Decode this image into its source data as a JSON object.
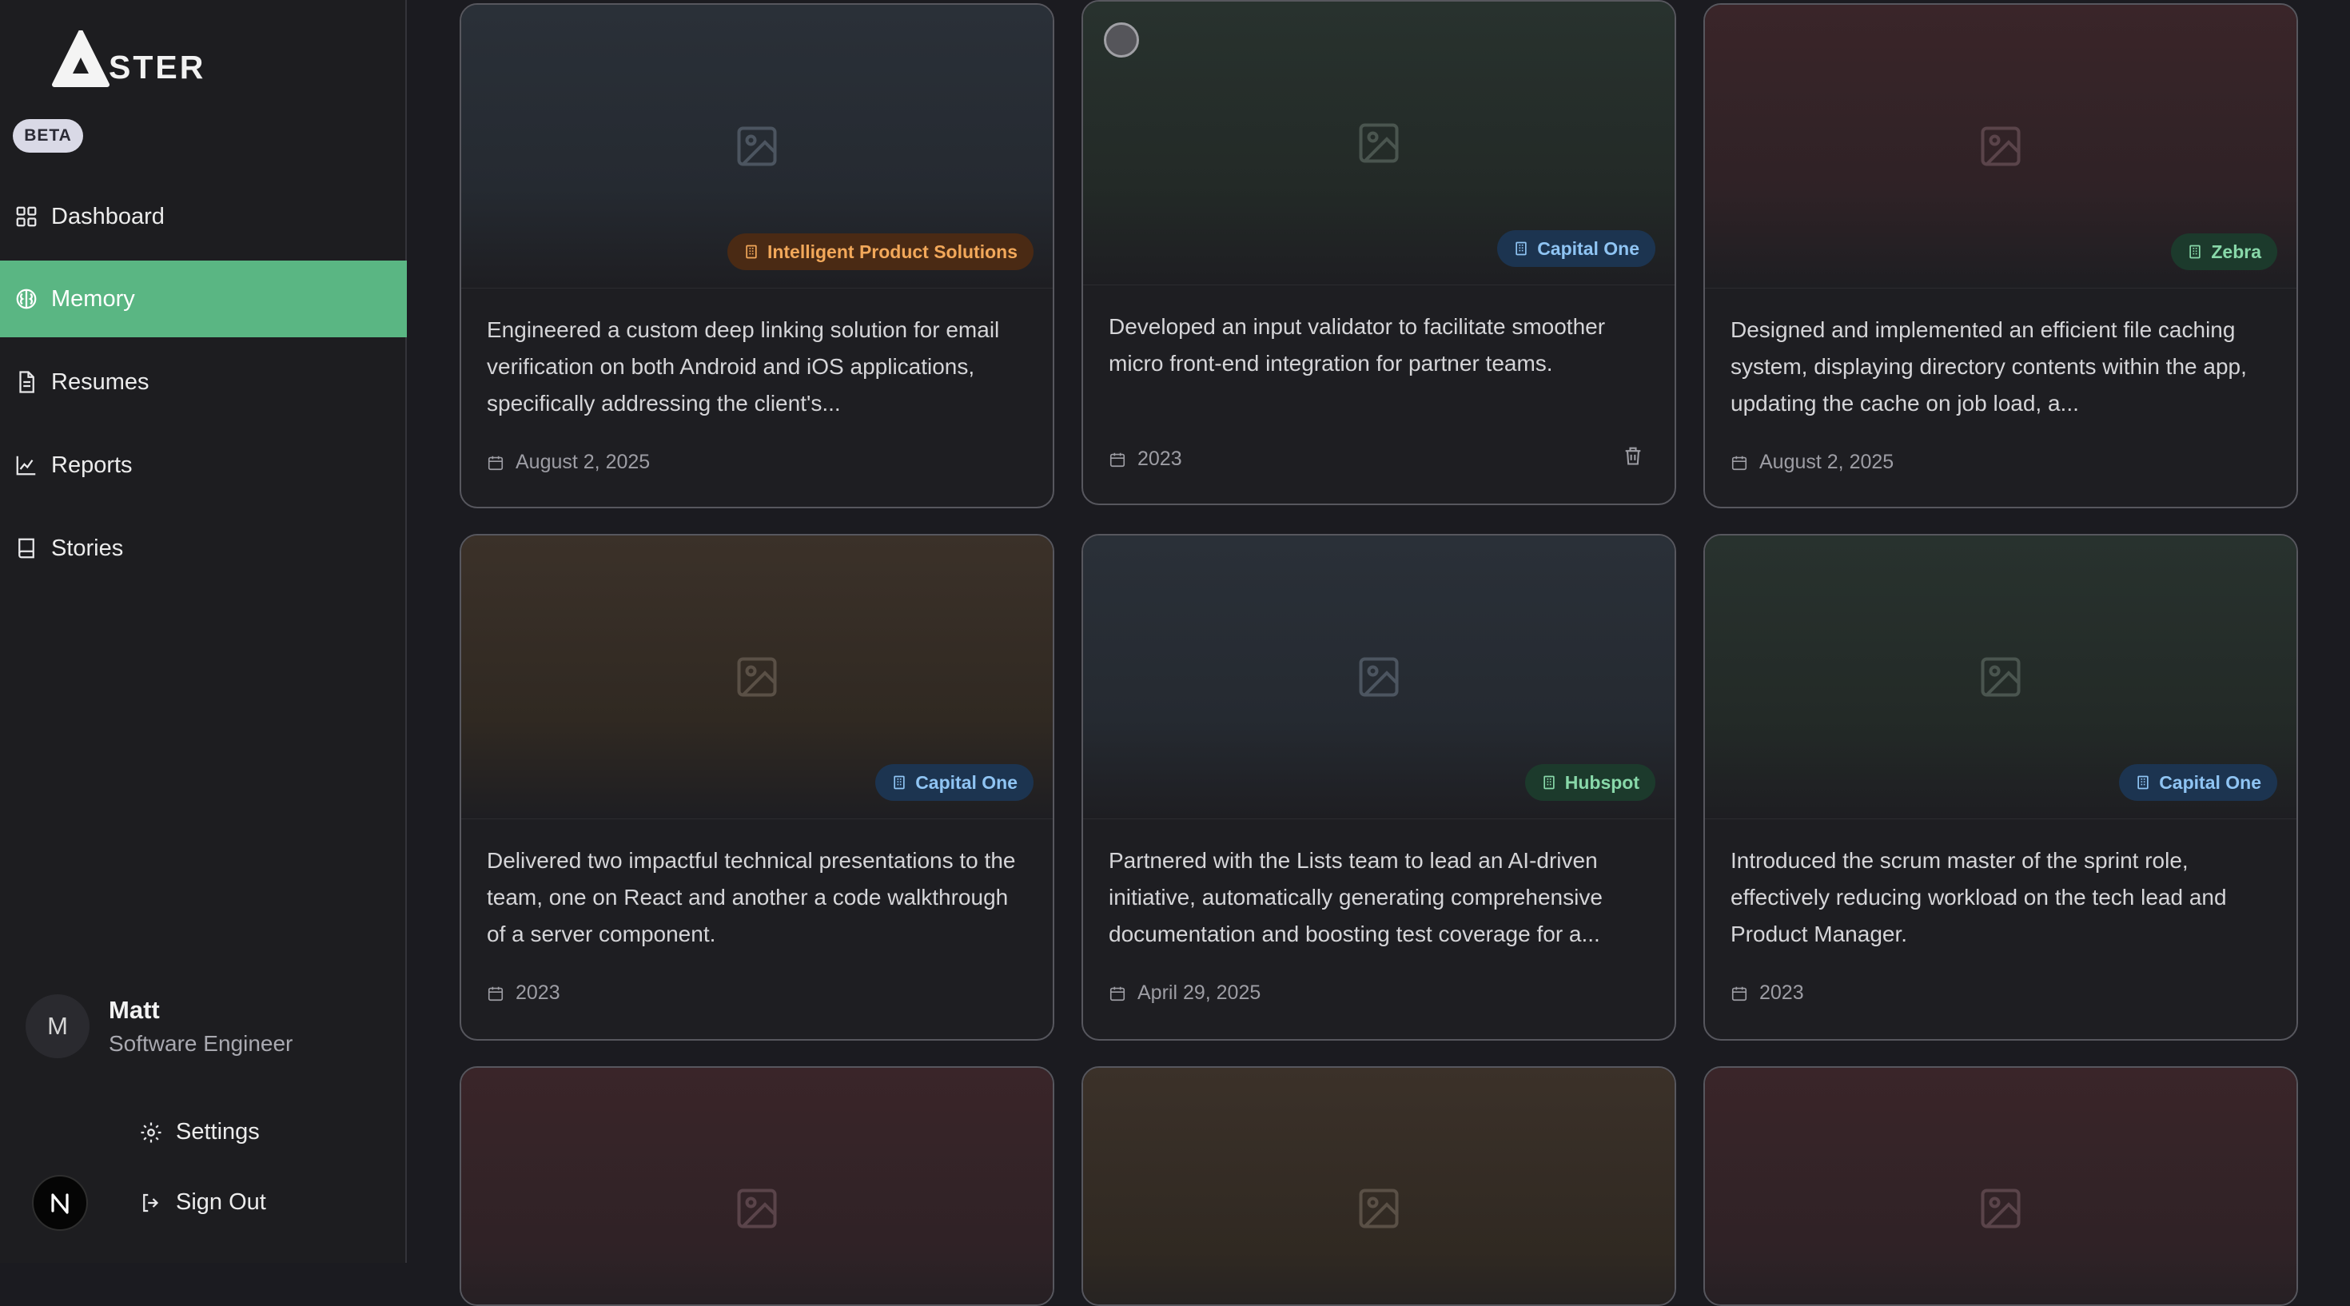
{
  "app": {
    "logo_text": "STER",
    "badge": "BETA"
  },
  "sidebar": {
    "nav": [
      {
        "label": "Dashboard",
        "icon": "grid-icon"
      },
      {
        "label": "Memory",
        "icon": "brain-icon",
        "active": true
      },
      {
        "label": "Resumes",
        "icon": "document-icon"
      },
      {
        "label": "Reports",
        "icon": "line-chart-icon"
      },
      {
        "label": "Stories",
        "icon": "book-icon"
      }
    ],
    "user": {
      "initial": "M",
      "name": "Matt",
      "role": "Software Engineer"
    },
    "settings_label": "Settings",
    "signout_label": "Sign Out"
  },
  "cards": [
    {
      "company": "Intelligent Product Solutions",
      "chip_color": "orange",
      "description": "Engineered a custom deep linking solution for email verification on both Android and iOS applications, specifically addressing the client's...",
      "date": "August 2, 2025"
    },
    {
      "company": "Capital One",
      "chip_color": "blue",
      "description": "Developed an input validator to facilitate smoother micro front-end integration for partner teams.",
      "date": "2023"
    },
    {
      "company": "Zebra",
      "chip_color": "green",
      "description": "Designed and implemented an efficient file caching system, displaying directory contents within the app, updating the cache on job load, a...",
      "date": "August 2, 2025"
    },
    {
      "company": "Capital One",
      "chip_color": "blue",
      "description": "Delivered two impactful technical presentations to the team, one on React and another a code walkthrough of a server component.",
      "date": "2023"
    },
    {
      "company": "Hubspot",
      "chip_color": "green",
      "description": "Partnered with the Lists team to lead an AI-driven initiative, automatically generating comprehensive documentation and boosting test coverage for a...",
      "date": "April 29, 2025"
    },
    {
      "company": "Capital One",
      "chip_color": "blue",
      "description": "Introduced the scrum master of the sprint role, effectively reducing workload on the tech lead and Product Manager.",
      "date": "2023"
    }
  ],
  "colors": {
    "accent": "#5ab683",
    "background": "#1b1b20",
    "card_border": "#57575e"
  }
}
